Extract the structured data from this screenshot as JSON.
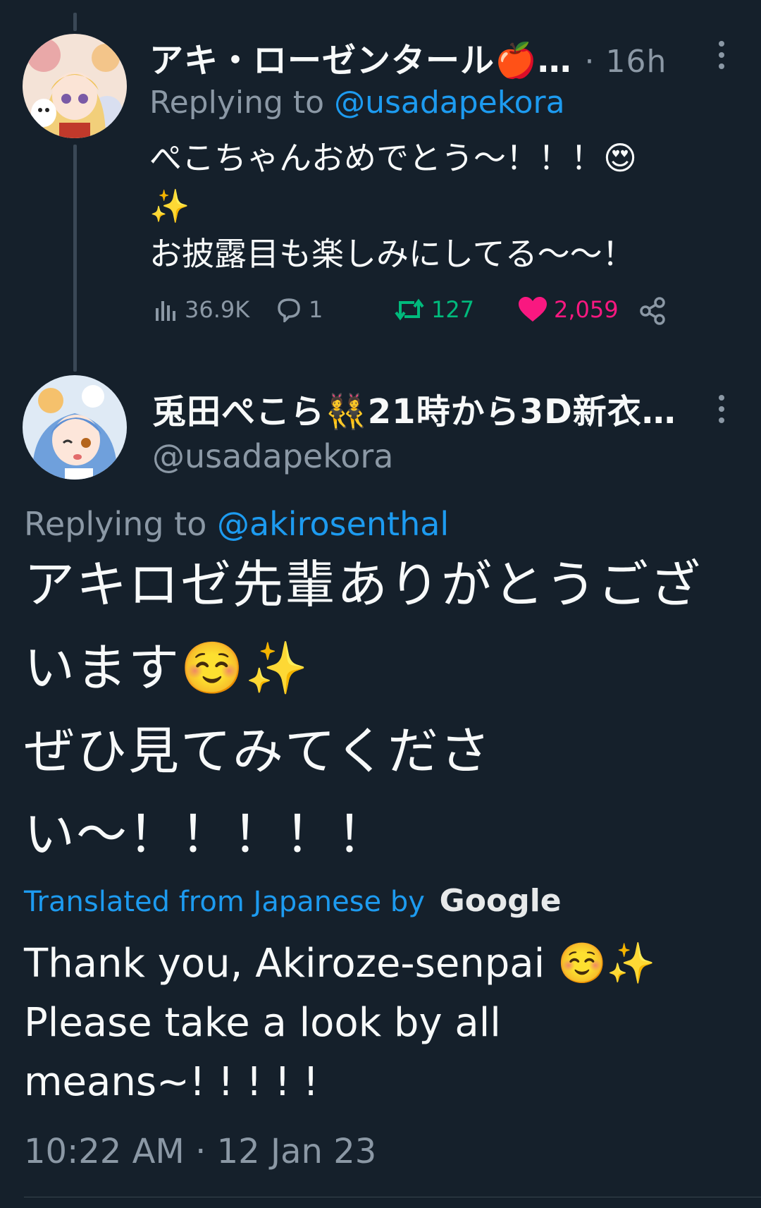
{
  "tweet1": {
    "display_name": "アキ・ローゼンタール🍎…",
    "time": "· 16h",
    "replying_prefix": "Replying to",
    "replying_handle": "@usadapekora",
    "text_line1": "ぺこちゃんおめでとう〜！！！😍",
    "text_line2": "✨",
    "text_line3": "お披露目も楽しみにしてる〜〜！",
    "views": "36.9K",
    "replies": "1",
    "retweets": "127",
    "likes": "2,059"
  },
  "tweet2": {
    "display_name": "兎田ぺこら👯21時から3D新衣…",
    "handle": "@usadapekora",
    "replying_prefix": "Replying to",
    "replying_handle": "@akirosenthal",
    "text_line1": "アキロゼ先輩ありがとうござ",
    "text_line2": "います☺️✨",
    "text_line3": "ぜひ見てみてくださ",
    "text_line4": "い〜！！！！！",
    "translated_label": "Translated from Japanese by",
    "translated_provider": "Google",
    "en_line1": "Thank you, Akiroze-senpai ☺️✨",
    "en_line2": "Please take a look by all",
    "en_line3": "means~! ! ! ! !",
    "timestamp": "10:22 AM · 12 Jan 23"
  },
  "colors": {
    "background": "#15202b",
    "link": "#1d9bf0",
    "muted": "#8b98a5",
    "retweet": "#00ba7c",
    "like": "#f91880"
  }
}
